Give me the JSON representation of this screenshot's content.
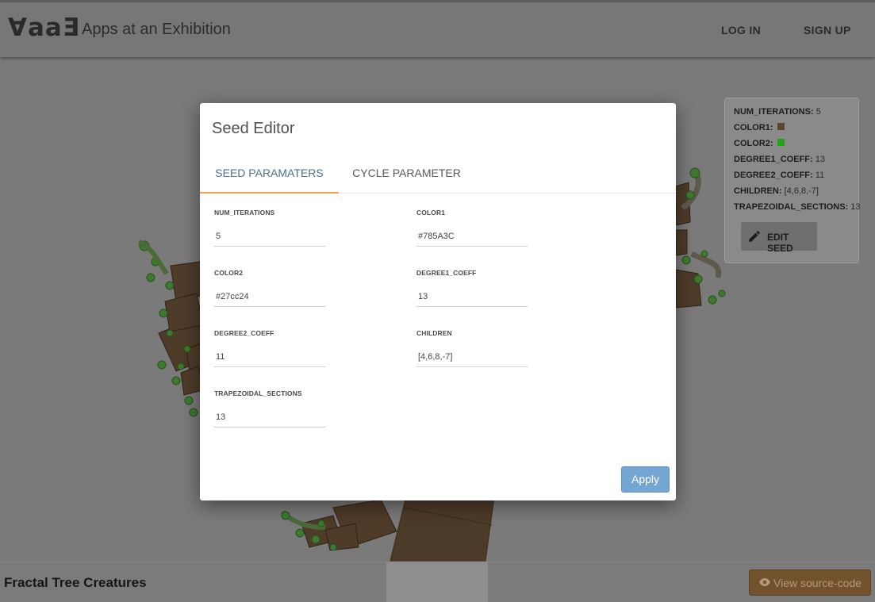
{
  "header": {
    "logo": "∀aaƎ",
    "title": "Apps at an Exhibition",
    "login_label": "LOG IN",
    "signup_label": "SIGN UP"
  },
  "seed_panel": {
    "rows": [
      {
        "key": "NUM_ITERATIONS:",
        "value": "5"
      },
      {
        "key": "COLOR1:",
        "swatch": "#785A3C"
      },
      {
        "key": "COLOR2:",
        "swatch": "#27cc24"
      },
      {
        "key": "DEGREE1_COEFF:",
        "value": "13"
      },
      {
        "key": "DEGREE2_COEFF:",
        "value": "11"
      },
      {
        "key": "CHILDREN:",
        "value": "[4,6,8,-7]"
      },
      {
        "key": "TRAPEZOIDAL_SECTIONS:",
        "value": "13"
      }
    ],
    "edit_label": "EDIT SEED",
    "edit_icon": "pencil-icon"
  },
  "modal": {
    "title": "Seed Editor",
    "tabs": [
      {
        "label": "SEED PARAMATERS",
        "active": true
      },
      {
        "label": "CYCLE PARAMETER",
        "active": false
      }
    ],
    "fields": [
      {
        "label": "NUM_ITERATIONS",
        "value": "5"
      },
      {
        "label": "COLOR1",
        "value": "#785A3C"
      },
      {
        "label": "COLOR2",
        "value": "#27cc24"
      },
      {
        "label": "DEGREE1_COEFF",
        "value": "13"
      },
      {
        "label": "DEGREE2_COEFF",
        "value": "11"
      },
      {
        "label": "CHILDREN",
        "value": "[4,6,8,-7]"
      },
      {
        "label": "TRAPEZOIDAL_SECTIONS",
        "value": "13"
      }
    ],
    "apply_label": "Apply"
  },
  "footer": {
    "title": "Fractal Tree Creatures",
    "source_label": "View source-code",
    "source_icon": "eye-icon"
  },
  "colors": {
    "accent_tab": "#f3a34c",
    "apply_button": "#74a6d4",
    "source_button": "#72512d"
  }
}
